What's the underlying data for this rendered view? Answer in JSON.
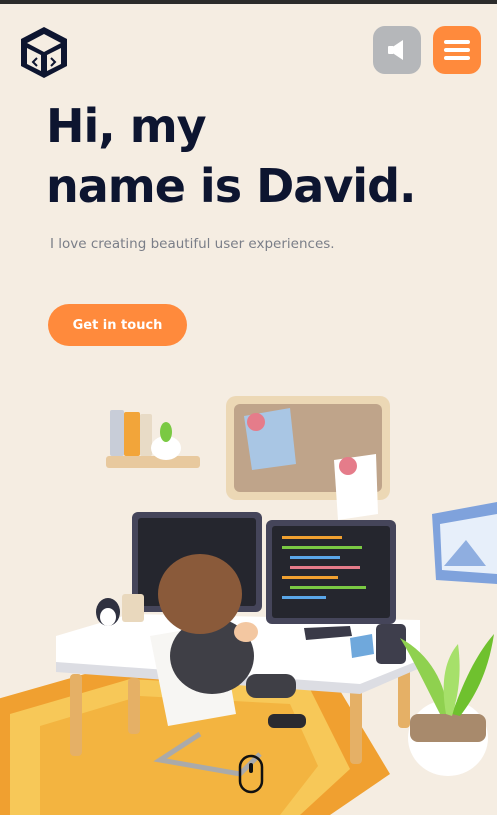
{
  "header": {
    "logo": "code-cube-logo",
    "sound_icon": "speaker-icon",
    "menu_icon": "hamburger-icon"
  },
  "hero": {
    "headline_line1": "Hi, my",
    "headline_line2": "name is David.",
    "tagline": "I love creating beautiful user experiences.",
    "cta_label": "Get in touch"
  },
  "colors": {
    "background": "#f5ede2",
    "accent": "#ff8a3c",
    "heading": "#0d1530",
    "muted_button": "#b5b7ba"
  },
  "scroll_indicator_icon": "mouse-icon"
}
